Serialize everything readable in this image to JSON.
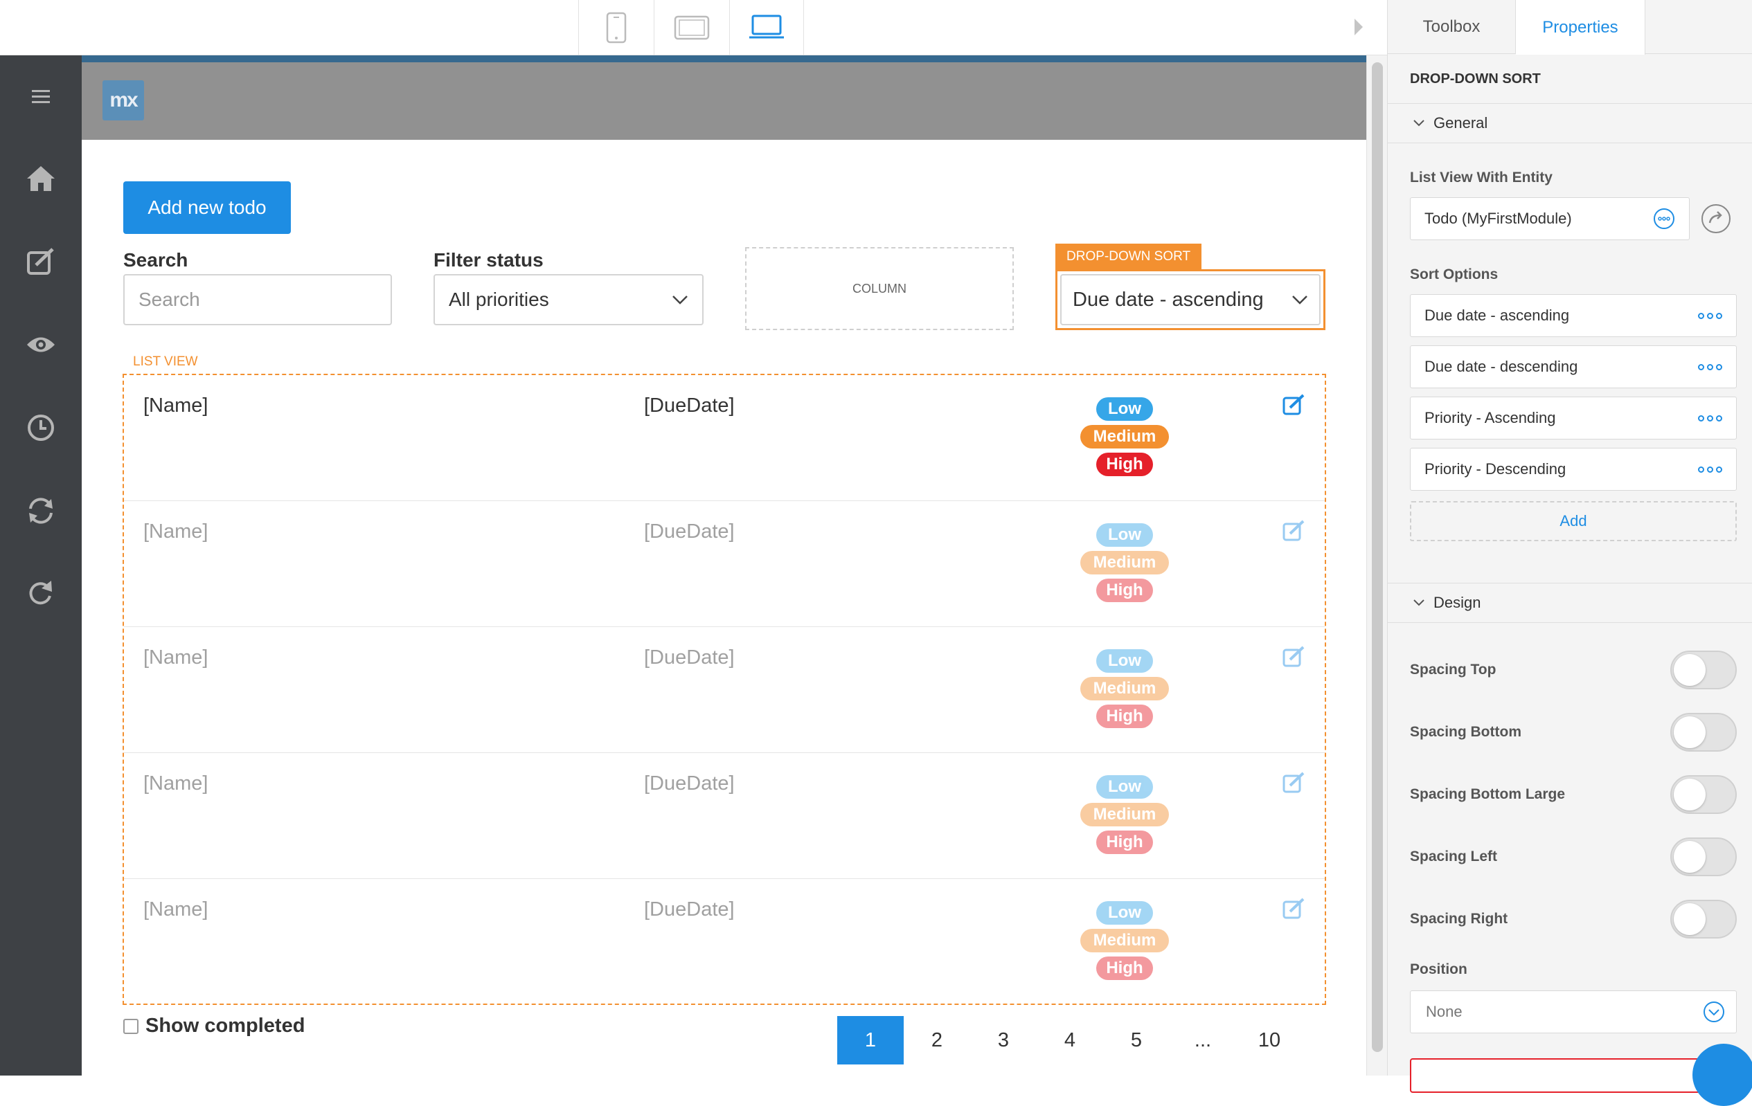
{
  "device_bar": {
    "devices": [
      "phone",
      "tablet",
      "desktop"
    ],
    "active": "desktop",
    "accent": "#1e8de3"
  },
  "sidebar": {
    "items": [
      "menu-icon",
      "home-icon",
      "edit-icon",
      "eye-icon",
      "clock-icon",
      "sync-icon",
      "refresh-icon"
    ]
  },
  "app": {
    "logo_text": "mx",
    "add_button": "Add new todo",
    "search": {
      "label": "Search",
      "placeholder": "Search"
    },
    "filter": {
      "label": "Filter status",
      "value": "All priorities"
    },
    "column_placeholder": "COLUMN",
    "dropdown_sort": {
      "tag": "DROP-DOWN SORT",
      "value": "Due date - ascending"
    },
    "list_view": {
      "tag": "LIST VIEW",
      "rows": [
        {
          "name": "[Name]",
          "date": "[DueDate]",
          "badges": [
            "Low",
            "Medium",
            "High"
          ]
        },
        {
          "name": "[Name]",
          "date": "[DueDate]",
          "badges": [
            "Low",
            "Medium",
            "High"
          ]
        },
        {
          "name": "[Name]",
          "date": "[DueDate]",
          "badges": [
            "Low",
            "Medium",
            "High"
          ]
        },
        {
          "name": "[Name]",
          "date": "[DueDate]",
          "badges": [
            "Low",
            "Medium",
            "High"
          ]
        },
        {
          "name": "[Name]",
          "date": "[DueDate]",
          "badges": [
            "Low",
            "Medium",
            "High"
          ]
        }
      ]
    },
    "show_completed": "Show completed",
    "pager": [
      "1",
      "2",
      "3",
      "4",
      "5",
      "...",
      "10"
    ],
    "pager_active": "1"
  },
  "panel": {
    "tabs": [
      "Toolbox",
      "Properties"
    ],
    "active_tab": "Properties",
    "title": "DROP-DOWN SORT",
    "general": {
      "heading": "General",
      "entity_label": "List View With Entity",
      "entity_value": "Todo (MyFirstModule)",
      "sort_label": "Sort Options",
      "sort_options": [
        "Due date - ascending",
        "Due date - descending",
        "Priority - Ascending",
        "Priority - Descending"
      ],
      "add": "Add"
    },
    "design": {
      "heading": "Design",
      "toggles": [
        "Spacing Top",
        "Spacing Bottom",
        "Spacing Bottom Large",
        "Spacing Left",
        "Spacing Right"
      ],
      "position_label": "Position",
      "position_value": "None"
    }
  },
  "colors": {
    "accent": "#1e8de3",
    "selection": "#f39030",
    "low": "#36a6e8",
    "medium": "#f39030",
    "high": "#e5202a",
    "sidebar": "#3e4145"
  }
}
